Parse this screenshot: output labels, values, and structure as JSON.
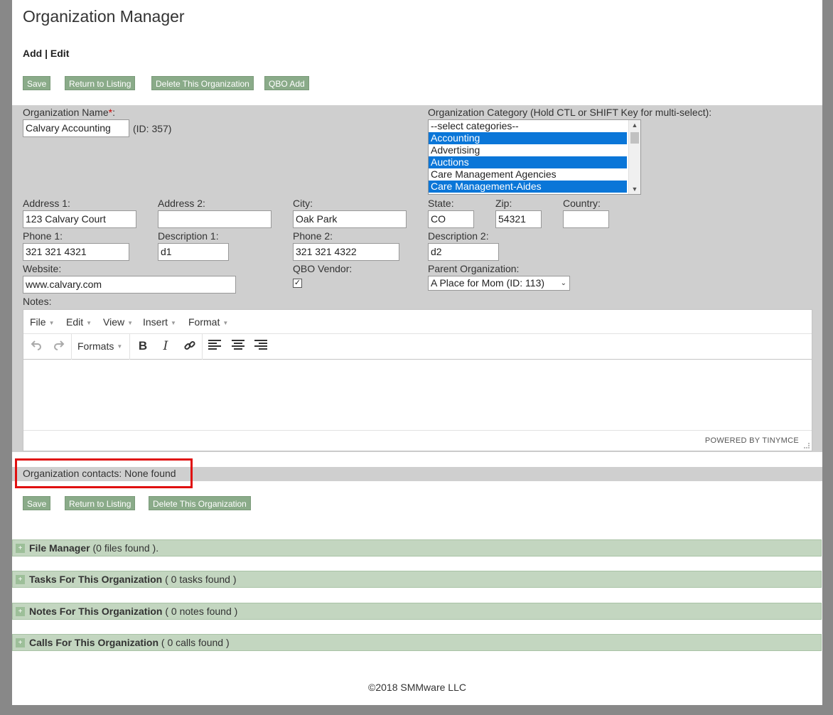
{
  "header": {
    "title": "Organization Manager",
    "mode": "Add | Edit"
  },
  "top_buttons": {
    "save": "Save",
    "return": "Return to Listing",
    "delete": "Delete This Organization",
    "qbo": "QBO Add"
  },
  "bottom_buttons": {
    "save": "Save",
    "return": "Return to Listing",
    "delete": "Delete This Organization"
  },
  "form": {
    "org_name": {
      "label": "Organization Name",
      "required_mark": "*",
      "colon": ":",
      "value": "Calvary Accounting",
      "id_text": "(ID: 357)"
    },
    "category": {
      "label": "Organization Category (Hold CTL or SHIFT Key for multi-select):",
      "options": [
        {
          "label": "--select categories--",
          "selected": false
        },
        {
          "label": "Accounting",
          "selected": true
        },
        {
          "label": "Advertising",
          "selected": false
        },
        {
          "label": "Auctions",
          "selected": true
        },
        {
          "label": "Care Management Agencies",
          "selected": false
        },
        {
          "label": "Care Management-Aides",
          "selected": true
        }
      ]
    },
    "address1": {
      "label": "Address 1:",
      "value": "123 Calvary Court"
    },
    "address2": {
      "label": "Address 2:",
      "value": ""
    },
    "city": {
      "label": "City:",
      "value": "Oak Park"
    },
    "state": {
      "label": "State:",
      "value": "CO"
    },
    "zip": {
      "label": "Zip:",
      "value": "54321"
    },
    "country": {
      "label": "Country:",
      "value": ""
    },
    "phone1": {
      "label": "Phone 1:",
      "value": "321 321 4321"
    },
    "desc1": {
      "label": "Description 1:",
      "value": "d1"
    },
    "phone2": {
      "label": "Phone 2:",
      "value": "321 321 4322"
    },
    "desc2": {
      "label": "Description 2:",
      "value": "d2"
    },
    "website": {
      "label": "Website:",
      "value": "www.calvary.com"
    },
    "qbo_vendor": {
      "label": "QBO Vendor:",
      "checked": true,
      "check_glyph": "✓"
    },
    "parent_org": {
      "label": "Parent Organization:",
      "value": "A Place for Mom (ID: 113)"
    },
    "notes": {
      "label": "Notes:"
    }
  },
  "editor": {
    "menus": [
      "File",
      "Edit",
      "View",
      "Insert",
      "Format"
    ],
    "formats_label": "Formats",
    "powered_by": "POWERED BY TINYMCE"
  },
  "contacts": {
    "text": "Organization contacts: None found"
  },
  "panels": [
    {
      "title": "File Manager",
      "count": " (0 files found )."
    },
    {
      "title": "Tasks For This Organization",
      "count": " ( 0 tasks found )"
    },
    {
      "title": "Notes For This Organization",
      "count": " ( 0 notes found )"
    },
    {
      "title": "Calls For This Organization",
      "count": " ( 0 calls found )"
    }
  ],
  "footer": {
    "text": "©2018 SMMware LLC"
  },
  "icons": {
    "undo": "undo-icon",
    "redo": "redo-icon",
    "bold": "bold-icon",
    "italic": "italic-icon",
    "link": "link-icon",
    "align_left": "align-left-icon",
    "align_center": "align-center-icon",
    "align_right": "align-right-icon",
    "expand": "plus-icon"
  },
  "colors": {
    "button": "#8aab89",
    "panel": "#c3d6c0",
    "form_bg": "#cfcfcf",
    "selected_option": "#0a76d8",
    "highlight": "#e01010"
  }
}
